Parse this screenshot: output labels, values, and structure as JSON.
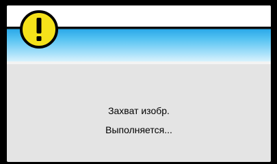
{
  "dialog": {
    "icon": "warning-exclamation-icon",
    "accent_color": "#2aa8e8",
    "warning_color": "#f5e21a",
    "message_line1": "Захват изобр.",
    "message_line2": "Выполняется..."
  }
}
